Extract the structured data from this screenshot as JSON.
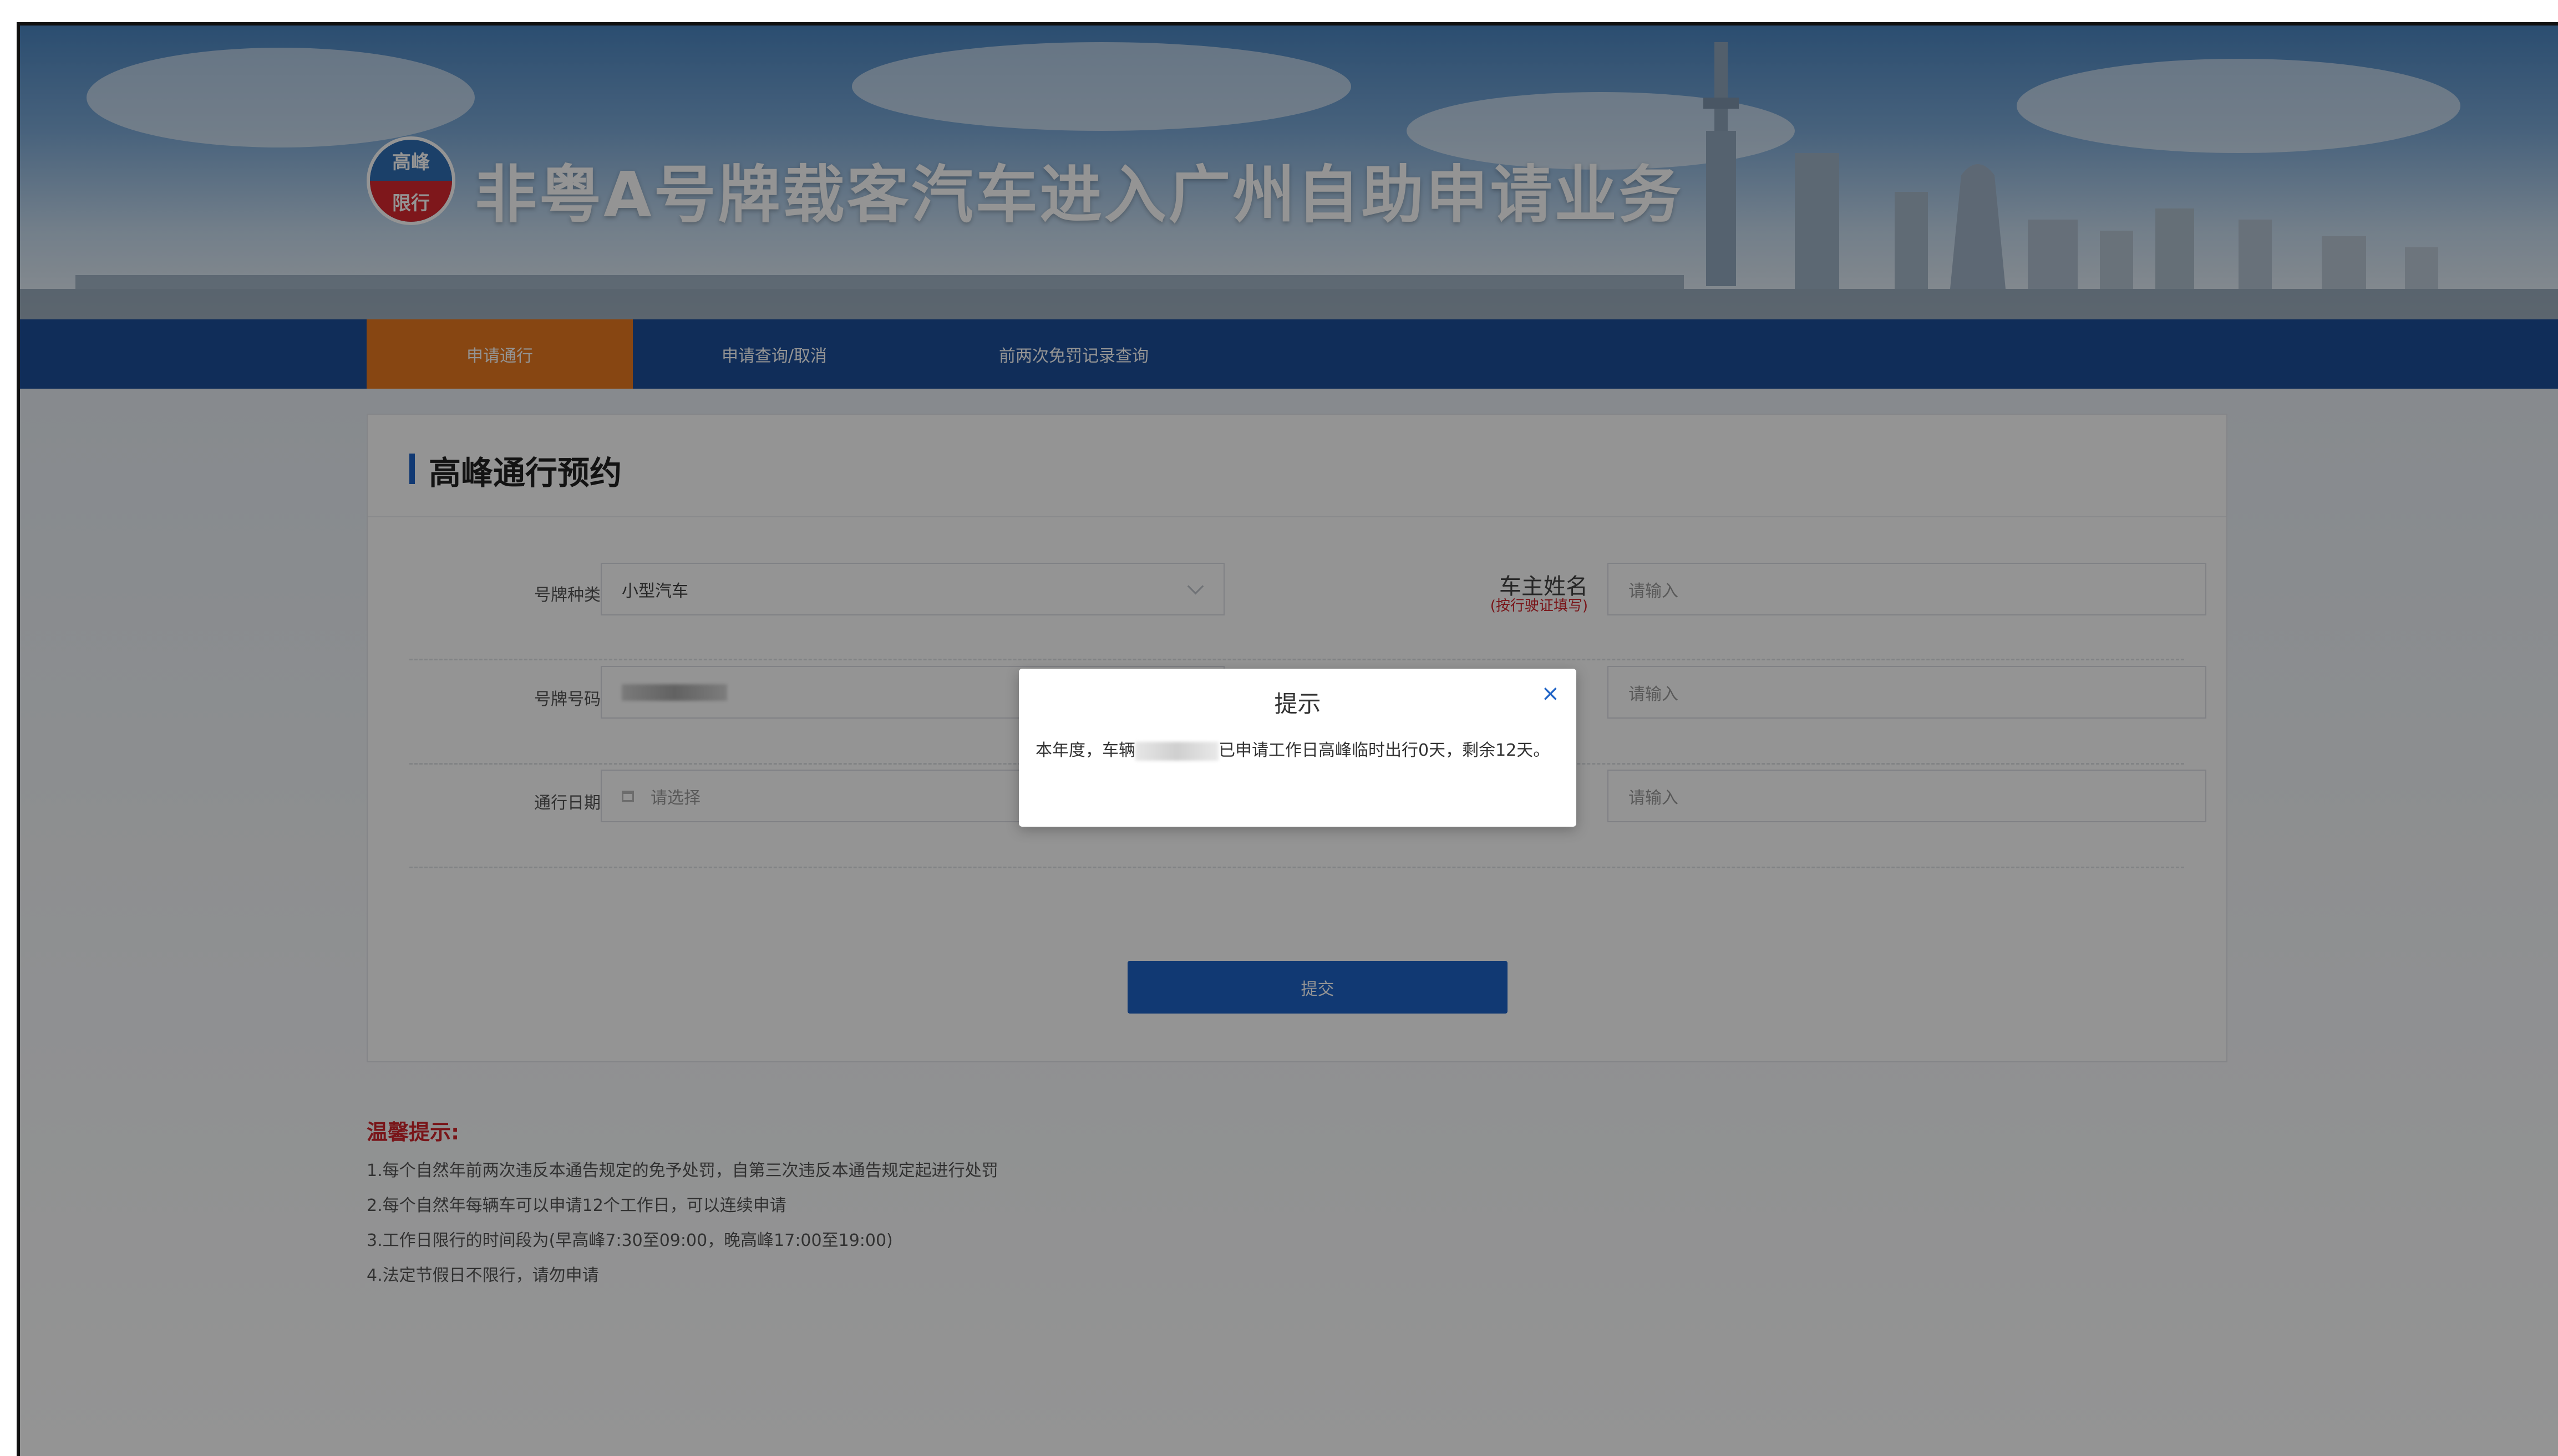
{
  "header": {
    "logo_top": "高峰",
    "logo_bottom": "限行",
    "title": "非粤A号牌载客汽车进入广州自助申请业务"
  },
  "nav": {
    "items": [
      {
        "label": "申请通行",
        "active": true
      },
      {
        "label": "申请查询/取消",
        "active": false
      },
      {
        "label": "前两次免罚记录查询",
        "active": false
      }
    ]
  },
  "form": {
    "title": "高峰通行预约",
    "plate_type_label": "号牌种类",
    "plate_type_value": "小型汽车",
    "plate_number_label": "号牌号码",
    "travel_date_label": "通行日期",
    "travel_date_placeholder": "请选择",
    "owner_name_label": "车主姓名",
    "owner_name_hint": "(按行驶证填写)",
    "input_placeholder": "请输入",
    "submit_label": "提交"
  },
  "tips": {
    "title": "温馨提示:",
    "lines": [
      "1.每个自然年前两次违反本通告规定的免予处罚，自第三次违反本通告规定起进行处罚",
      "2.每个自然年每辆车可以申请12个工作日，可以连续申请",
      "3.工作日限行的时间段为(早高峰7:30至09:00，晚高峰17:00至19:00)",
      "4.法定节假日不限行，请勿申请"
    ]
  },
  "dialog": {
    "title": "提示",
    "close": "×",
    "body_prefix": "本年度，车辆",
    "body_suffix": "已申请工作日高峰临时出行0天，剩余12天。"
  },
  "colors": {
    "nav_bg": "#1d4f99",
    "nav_active": "#e8791f",
    "primary": "#1e63c6",
    "required": "#d0252b"
  }
}
